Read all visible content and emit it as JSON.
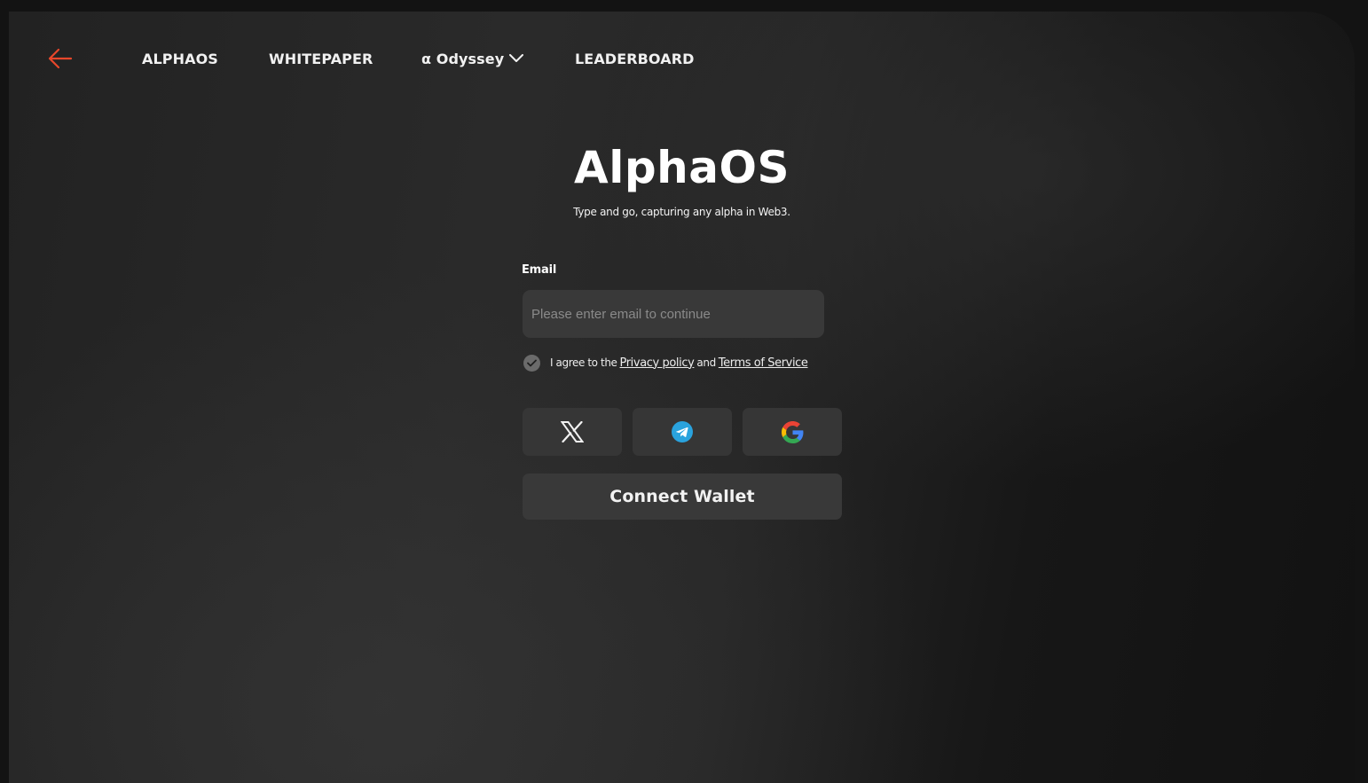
{
  "nav": {
    "items": [
      {
        "label": "ALPHAOS"
      },
      {
        "label": "WHITEPAPER"
      },
      {
        "label": "α Odyssey"
      },
      {
        "label": "LEADERBOARD"
      }
    ]
  },
  "hero": {
    "title": "AlphaOS",
    "subtitle": "Type and go, capturing any alpha in Web3."
  },
  "form": {
    "email_label": "Email",
    "email_placeholder": "Please enter email to continue",
    "email_value": "",
    "agree_prefix": "I agree to the",
    "privacy_link": "Privacy policy",
    "and_text": "and",
    "terms_link": "Terms of Service",
    "agree_checked": true
  },
  "social": [
    {
      "icon": "x-logo-icon"
    },
    {
      "icon": "telegram-icon"
    },
    {
      "icon": "google-icon"
    }
  ],
  "connect_wallet_label": "Connect Wallet",
  "colors": {
    "accent_arrow": "#e8472b",
    "telegram_blue": "#2aa3de"
  }
}
